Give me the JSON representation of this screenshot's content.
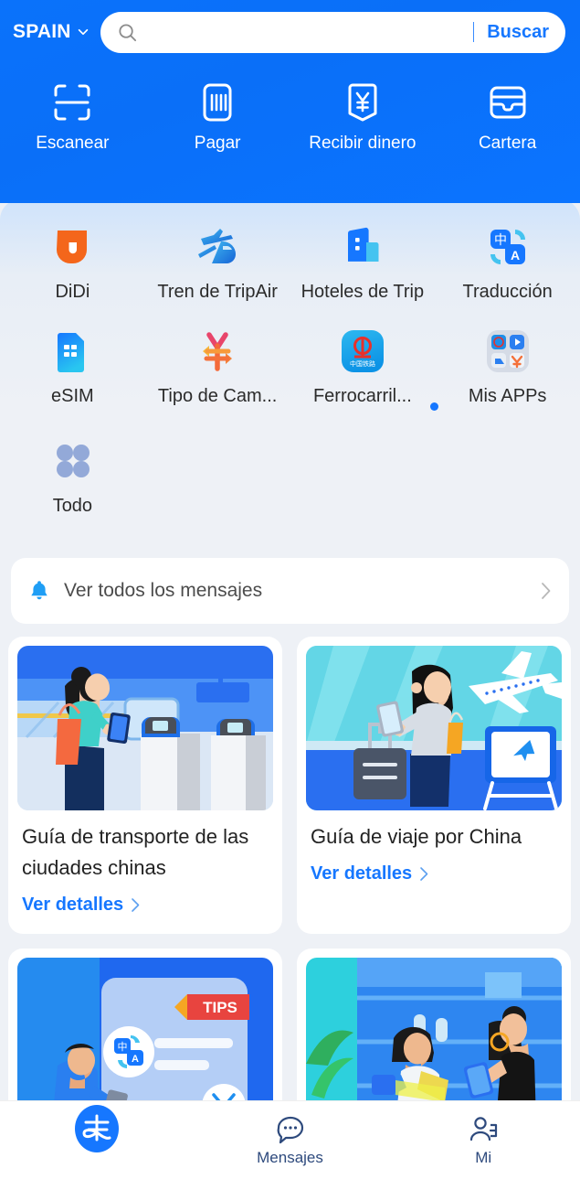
{
  "colors": {
    "brand_blue": "#1677ff",
    "header_blue": "#0a72fb",
    "panel_bg": "#eef1f6",
    "card_white": "#ffffff",
    "text_dark": "#2b2b2b",
    "nav_label": "#2e4a7d",
    "didi_orange": "#f4661b",
    "badge_dot": "#1677ff"
  },
  "header": {
    "region_label": "SPAIN",
    "region_chevron_icon": "chevron-down-icon",
    "search": {
      "icon": "search-icon",
      "value": "",
      "placeholder": "",
      "button_label": "Buscar"
    },
    "quick_actions": [
      {
        "label": "Escanear",
        "icon": "scan-icon"
      },
      {
        "label": "Pagar",
        "icon": "barcode-pay-icon"
      },
      {
        "label": "Recibir dinero",
        "icon": "receive-money-yen-icon"
      },
      {
        "label": "Cartera",
        "icon": "wallet-icon"
      }
    ]
  },
  "app_grid": {
    "rows": [
      [
        {
          "label": "DiDi",
          "icon": "didi-icon",
          "badge": false
        },
        {
          "label": "Tren de TripAir",
          "icon": "train-plane-icon",
          "badge": false
        },
        {
          "label": "Hoteles de Trip",
          "icon": "hotel-building-icon",
          "badge": false
        },
        {
          "label": "Traducción",
          "icon": "translate-icon",
          "badge": false
        }
      ],
      [
        {
          "label": "eSIM",
          "icon": "esim-card-icon",
          "badge": false
        },
        {
          "label": "Tipo de Cam...",
          "icon": "exchange-rate-yen-icon",
          "badge": false
        },
        {
          "label": "Ferrocarril...",
          "icon": "china-railway-icon",
          "badge": true
        },
        {
          "label": "Mis APPs",
          "icon": "my-apps-grid-icon",
          "badge": false
        }
      ],
      [
        {
          "label": "Todo",
          "icon": "all-apps-dots-icon",
          "badge": false
        }
      ]
    ]
  },
  "messages_bar": {
    "icon": "bell-icon",
    "label": "Ver todos los mensajes",
    "chevron_icon": "chevron-right-icon"
  },
  "cards": [
    {
      "title": "Guía de transporte de las ciudades chinas",
      "link_label": "Ver detalles",
      "image": "woman-at-metro-turnstile-illustration"
    },
    {
      "title": "Guía de viaje por China",
      "link_label": "Ver detalles",
      "image": "woman-at-airport-with-plane-illustration"
    },
    {
      "title": "",
      "link_label": "",
      "image": "man-with-phone-translation-tips-illustration"
    },
    {
      "title": "",
      "link_label": "",
      "image": "shop-qr-payment-illustration"
    }
  ],
  "bottom_nav": [
    {
      "label": "",
      "icon": "alipay-home-icon",
      "active": true
    },
    {
      "label": "Mensajes",
      "icon": "chat-bubble-icon",
      "active": false
    },
    {
      "label": "Mi",
      "icon": "profile-person-icon",
      "active": false
    }
  ]
}
